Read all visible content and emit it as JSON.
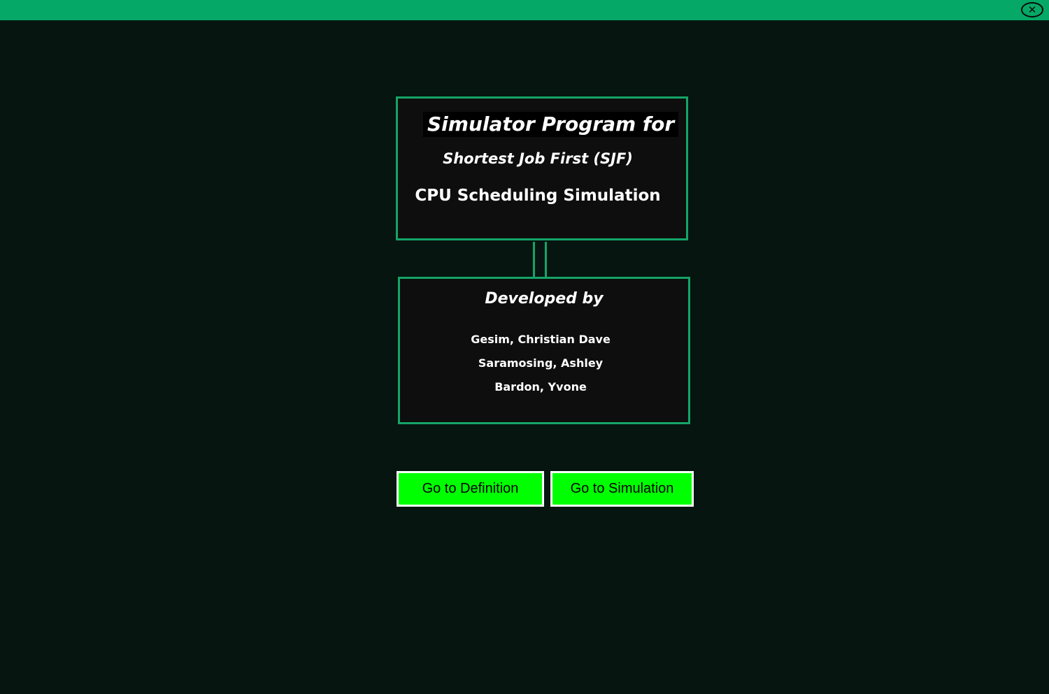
{
  "window": {
    "close_symbol": "✕"
  },
  "title_box": {
    "line1": "Simulator Program for",
    "line2": "Shortest Job First (SJF)",
    "line3": "CPU Scheduling Simulation"
  },
  "developers": {
    "heading": "Developed by",
    "names": [
      "Gesim, Christian Dave",
      "Saramosing, Ashley",
      "Bardon, Yvone"
    ]
  },
  "buttons": {
    "definition_label": "Go to Definition",
    "simulation_label": "Go to Simulation"
  },
  "colors": {
    "top_bar": "#05a866",
    "background": "#061510",
    "border_accent": "#14a467",
    "button_fill": "#00ff00"
  },
  "icons": {
    "close": "close-circle-icon"
  }
}
